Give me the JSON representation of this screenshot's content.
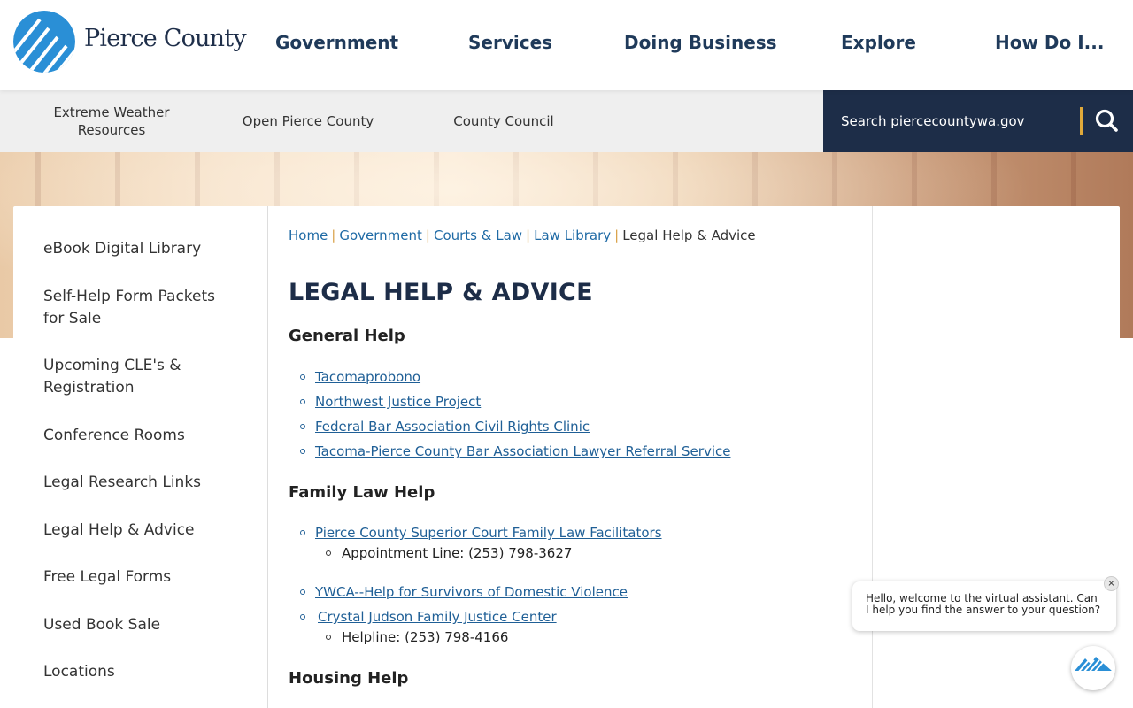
{
  "header": {
    "logo_text": "Pierce County",
    "nav": [
      "Government",
      "Services",
      "Doing Business",
      "Explore",
      "How Do I..."
    ]
  },
  "subnav": {
    "links": [
      "Extreme Weather Resources",
      "Open Pierce County",
      "County Council"
    ],
    "search_placeholder": "Search piercecountywa.gov"
  },
  "sidebar": {
    "items": [
      "eBook Digital Library",
      "Self-Help Form Packets for Sale",
      "Upcoming CLE's & Registration",
      "Conference Rooms",
      "Legal Research Links",
      "Legal Help & Advice",
      "Free Legal Forms",
      "Used Book Sale",
      "Locations"
    ]
  },
  "breadcrumb": {
    "links": [
      "Home",
      "Government",
      "Courts & Law",
      "Law Library"
    ],
    "current": "Legal Help & Advice",
    "separator": "|"
  },
  "page": {
    "title": "LEGAL HELP & ADVICE",
    "sections": [
      {
        "heading": "General Help",
        "links": [
          "Tacomaprobono",
          "Northwest Justice Project",
          "Federal Bar Association Civil Rights Clinic",
          "Tacoma-Pierce County Bar Association Lawyer Referral Service"
        ]
      },
      {
        "heading": "Family Law Help",
        "links": [
          "Pierce County Superior Court Family Law Facilitators",
          "YWCA--Help for Survivors of Domestic Violence",
          "Crystal Judson Family Justice Center"
        ],
        "details": [
          "Appointment Line: (253) 798-3627",
          "Helpline: (253) 798-4166"
        ]
      },
      {
        "heading": "Housing Help"
      }
    ]
  },
  "chat": {
    "message": "Hello, welcome to the virtual assistant. Can I help you find the answer to your question?",
    "close_glyph": "×"
  },
  "colors": {
    "navy": "#1d2d48",
    "link": "#1f5f96",
    "accent": "#e0a93a",
    "logo_blue": "#2a8fd6"
  }
}
